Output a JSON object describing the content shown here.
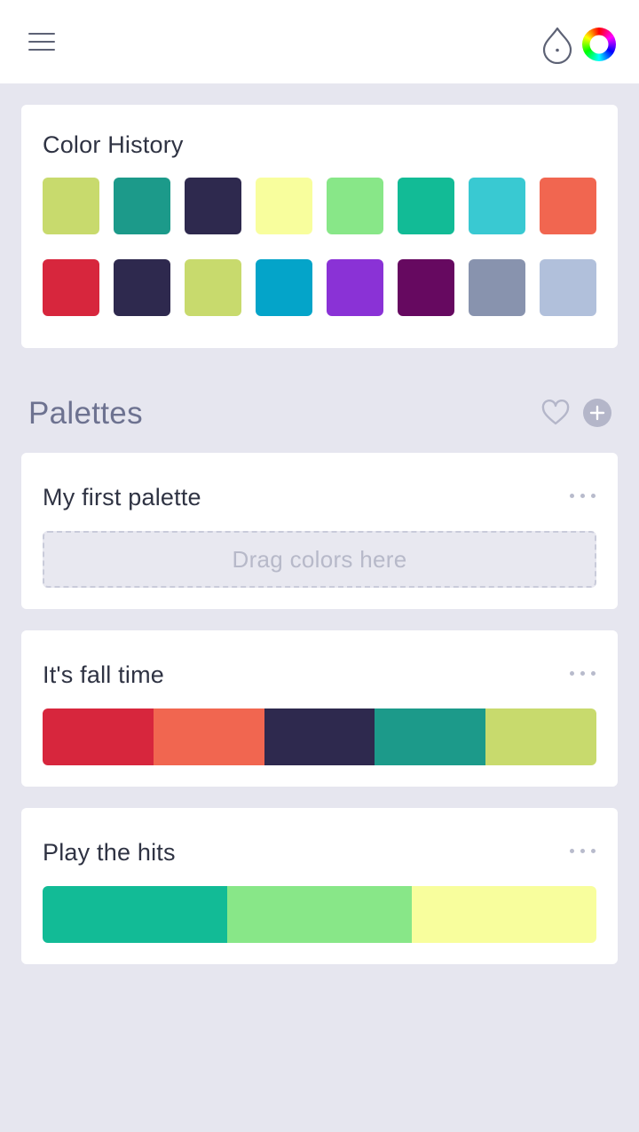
{
  "header": {
    "menu_icon": "hamburger-menu-icon",
    "drop_icon": "color-drop-icon",
    "wheel_icon": "color-wheel-icon"
  },
  "color_history": {
    "title": "Color History",
    "colors": [
      "#c8da6d",
      "#1c9a8a",
      "#2e294e",
      "#f8fe9d",
      "#88e788",
      "#12bb96",
      "#39c9d2",
      "#f16650",
      "#d7263d",
      "#2e294e",
      "#c8da6d",
      "#04a4c9",
      "#8a32d6",
      "#660960",
      "#8893ae",
      "#b1c0db"
    ]
  },
  "palettes": {
    "title": "Palettes",
    "favorite_icon": "heart-icon",
    "add_icon": "plus-icon",
    "items": [
      {
        "name": "My first palette",
        "empty_text": "Drag colors here",
        "colors": []
      },
      {
        "name": "It's fall time",
        "colors": [
          "#d7263d",
          "#f16650",
          "#2e294e",
          "#1c9a8a",
          "#c8da6d"
        ]
      },
      {
        "name": "Play the hits",
        "colors": [
          "#12bb96",
          "#88e788",
          "#f8fe9d"
        ]
      }
    ]
  }
}
